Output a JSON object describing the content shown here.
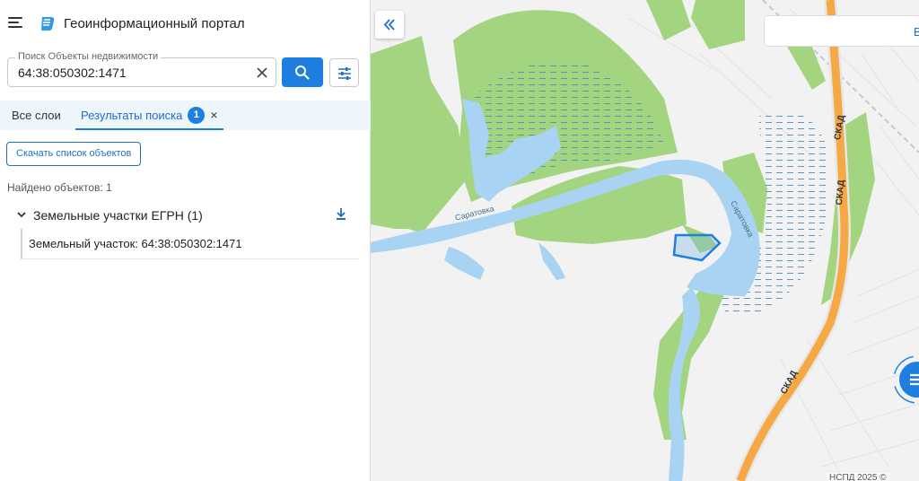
{
  "header": {
    "title": "Геоинформационный портал"
  },
  "search": {
    "label": "Поиск Объекты недвижимости",
    "value": "64:38:050302:1471"
  },
  "tabs": {
    "all_label": "Все слои",
    "results_label": "Результаты поиска",
    "results_count": "1",
    "close_symbol": "×"
  },
  "actions": {
    "download_list": "Скачать список объектов"
  },
  "results": {
    "found_text": "Найдено объектов: 1",
    "group_label": "Земельные участки ЕГРН (1)",
    "item_label": "Земельный участок: 64:38:050302:1471"
  },
  "map": {
    "top_right_text": "В",
    "copyright": "НСПД 2025 ©",
    "river_labels": [
      "Саратовка",
      "Саратовка"
    ],
    "road_labels": [
      "СКАД",
      "СКАД",
      "СКАД"
    ],
    "colors": {
      "water": "#a9d3f2",
      "forest": "#9fd27c",
      "road": "#f5a843",
      "parcel_outline": "#1e7fe0",
      "accent": "#1e7fe0"
    }
  },
  "icons": [
    "hamburger-icon",
    "portal-logo-icon",
    "clear-icon",
    "search-icon",
    "filter-icon",
    "chevron-down-icon",
    "download-icon",
    "collapse-left-icon",
    "chat-icon"
  ]
}
